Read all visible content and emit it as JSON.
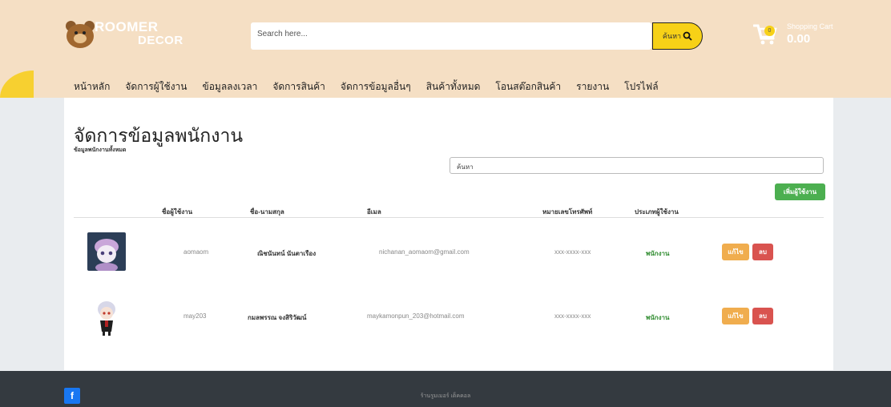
{
  "brand": {
    "line1": "ROOMER",
    "line2": "DECOR"
  },
  "search": {
    "placeholder": "Search here...",
    "button_label": "ค้นหา"
  },
  "cart": {
    "label": "Shopping Cart",
    "total": "0.00",
    "count": "0"
  },
  "nav": {
    "items": [
      {
        "label": "หน้าหลัก"
      },
      {
        "label": "จัดการผู้ใช้งาน"
      },
      {
        "label": "ข้อมูลลงเวลา"
      },
      {
        "label": "จัดการสินค้า"
      },
      {
        "label": "จัดการข้อมูลอื่นๆ"
      },
      {
        "label": "สินค้าทั้งหมด"
      },
      {
        "label": "โอนสต๊อกสินค้า"
      },
      {
        "label": "รายงาน"
      },
      {
        "label": "โปรไฟล์"
      }
    ]
  },
  "main": {
    "title": "จัดการข้อมูลพนักงาน",
    "subtitle": "ข้อมูลพนักงานทั้งหมด",
    "search_placeholder": "ค้นหา",
    "add_button": "เพิ่มผู้ใช้งาน",
    "columns": {
      "username": "ชื่อผู้ใช้งาน",
      "fullname": "ชื่อ-นามสกุล",
      "email": "อีเมล",
      "phone": "หมายเลขโทรศัพท์",
      "type": "ประเภทผู้ใช้งาน"
    },
    "rows": [
      {
        "username": "aomaom",
        "fullname": "ณิชนันทน์ นันตาเรือง",
        "email": "nichanan_aomaom@gmail.com",
        "phone": "xxx-xxxx-xxx",
        "type": "พนักงาน",
        "edit": "แก้ไข",
        "delete": "ลบ"
      },
      {
        "username": "may203",
        "fullname": "กมลพรรณ จงสิริวัฒน์",
        "email": "maykamonpun_203@hotmail.com",
        "phone": "xxx-xxxx-xxx",
        "type": "พนักงาน",
        "edit": "แก้ไข",
        "delete": "ลบ"
      }
    ]
  },
  "footer": {
    "text": "ร้านรูมเมอร์ เด็คคอล",
    "social_icon": "facebook-icon"
  },
  "colors": {
    "header_bg": "#f5dfc4",
    "accent_yellow": "#f7d117",
    "add_green": "#4caf50",
    "edit_orange": "#f0ad4e",
    "delete_red": "#d9534f",
    "footer_bg": "#343a40"
  }
}
